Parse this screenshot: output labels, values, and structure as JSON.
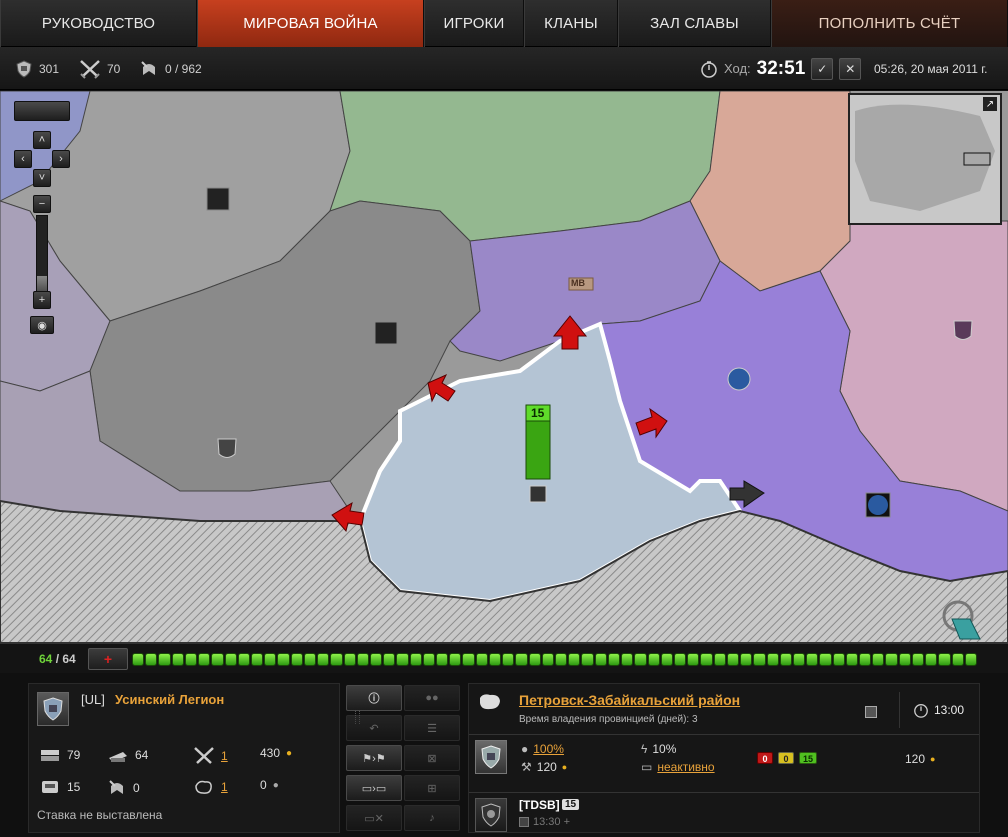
{
  "nav": {
    "tabs": [
      {
        "label": "РУКОВОДСТВО"
      },
      {
        "label": "МИРОВАЯ ВОЙНА"
      },
      {
        "label": "ИГРОКИ"
      },
      {
        "label": "КЛАНЫ"
      },
      {
        "label": "ЗАЛ СЛАВЫ"
      },
      {
        "label": "ПОПОЛНИТЬ СЧЁТ"
      }
    ],
    "active_index": 1
  },
  "status": {
    "provinces": "301",
    "battles": "70",
    "progress": "0 / 962",
    "turn_label": "Ход:",
    "turn_time": "32:51",
    "datetime": "05:26, 20 мая 2011 г."
  },
  "map": {
    "selected_province_tanks": "15",
    "regions": [
      "МВ"
    ]
  },
  "progress_bar": {
    "current": "64",
    "total": "64",
    "separator": " / ",
    "add_symbol": "+",
    "chip_count": 64
  },
  "clan": {
    "tag": "[UL]",
    "name": "Усинский Легион",
    "stats": {
      "tanks_total": "79",
      "tanks_moving": "64",
      "tanks_available": "15",
      "tanks_returning": "0",
      "battles": "1",
      "defenses": "1",
      "gold": "430",
      "credits": "0"
    },
    "bid_status": "Ставка не выставлена"
  },
  "province": {
    "name": "Петровск-Забайкальский район",
    "ownership_label": "Время владения провинцией (дней):",
    "ownership_days": "3",
    "prime_time": "13:00",
    "owner": {
      "revenue_percent": "100%",
      "revenue_value": "120",
      "tax_percent": "10%",
      "status": "неактивно",
      "badge_red": "0",
      "badge_yellow": "0",
      "badge_green": "15",
      "income": "120"
    },
    "attacker": {
      "tag": "TDSB",
      "count": "15",
      "time": "13:30 +"
    }
  }
}
